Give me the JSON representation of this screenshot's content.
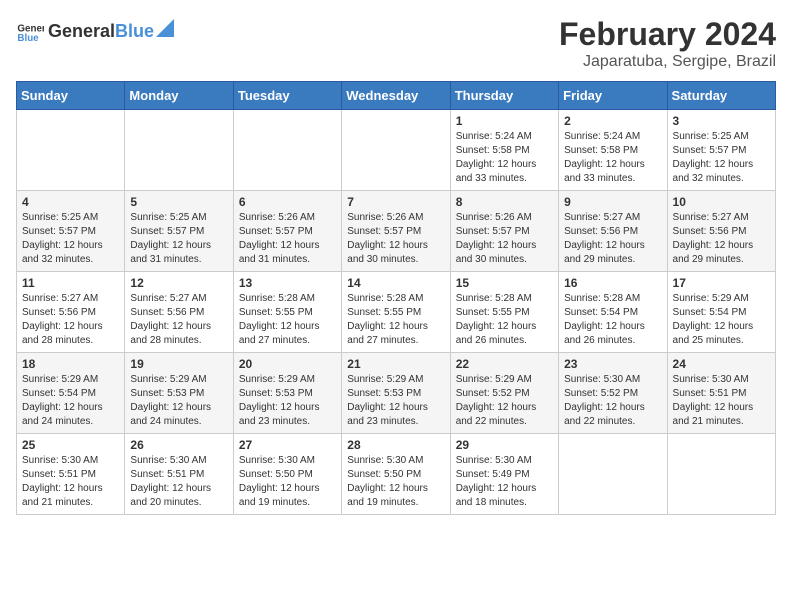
{
  "header": {
    "logo_general": "General",
    "logo_blue": "Blue",
    "month_year": "February 2024",
    "location": "Japaratuba, Sergipe, Brazil"
  },
  "days_of_week": [
    "Sunday",
    "Monday",
    "Tuesday",
    "Wednesday",
    "Thursday",
    "Friday",
    "Saturday"
  ],
  "weeks": [
    [
      {
        "day": "",
        "content": ""
      },
      {
        "day": "",
        "content": ""
      },
      {
        "day": "",
        "content": ""
      },
      {
        "day": "",
        "content": ""
      },
      {
        "day": "1",
        "content": "Sunrise: 5:24 AM\nSunset: 5:58 PM\nDaylight: 12 hours and 33 minutes."
      },
      {
        "day": "2",
        "content": "Sunrise: 5:24 AM\nSunset: 5:58 PM\nDaylight: 12 hours and 33 minutes."
      },
      {
        "day": "3",
        "content": "Sunrise: 5:25 AM\nSunset: 5:57 PM\nDaylight: 12 hours and 32 minutes."
      }
    ],
    [
      {
        "day": "4",
        "content": "Sunrise: 5:25 AM\nSunset: 5:57 PM\nDaylight: 12 hours and 32 minutes."
      },
      {
        "day": "5",
        "content": "Sunrise: 5:25 AM\nSunset: 5:57 PM\nDaylight: 12 hours and 31 minutes."
      },
      {
        "day": "6",
        "content": "Sunrise: 5:26 AM\nSunset: 5:57 PM\nDaylight: 12 hours and 31 minutes."
      },
      {
        "day": "7",
        "content": "Sunrise: 5:26 AM\nSunset: 5:57 PM\nDaylight: 12 hours and 30 minutes."
      },
      {
        "day": "8",
        "content": "Sunrise: 5:26 AM\nSunset: 5:57 PM\nDaylight: 12 hours and 30 minutes."
      },
      {
        "day": "9",
        "content": "Sunrise: 5:27 AM\nSunset: 5:56 PM\nDaylight: 12 hours and 29 minutes."
      },
      {
        "day": "10",
        "content": "Sunrise: 5:27 AM\nSunset: 5:56 PM\nDaylight: 12 hours and 29 minutes."
      }
    ],
    [
      {
        "day": "11",
        "content": "Sunrise: 5:27 AM\nSunset: 5:56 PM\nDaylight: 12 hours and 28 minutes."
      },
      {
        "day": "12",
        "content": "Sunrise: 5:27 AM\nSunset: 5:56 PM\nDaylight: 12 hours and 28 minutes."
      },
      {
        "day": "13",
        "content": "Sunrise: 5:28 AM\nSunset: 5:55 PM\nDaylight: 12 hours and 27 minutes."
      },
      {
        "day": "14",
        "content": "Sunrise: 5:28 AM\nSunset: 5:55 PM\nDaylight: 12 hours and 27 minutes."
      },
      {
        "day": "15",
        "content": "Sunrise: 5:28 AM\nSunset: 5:55 PM\nDaylight: 12 hours and 26 minutes."
      },
      {
        "day": "16",
        "content": "Sunrise: 5:28 AM\nSunset: 5:54 PM\nDaylight: 12 hours and 26 minutes."
      },
      {
        "day": "17",
        "content": "Sunrise: 5:29 AM\nSunset: 5:54 PM\nDaylight: 12 hours and 25 minutes."
      }
    ],
    [
      {
        "day": "18",
        "content": "Sunrise: 5:29 AM\nSunset: 5:54 PM\nDaylight: 12 hours and 24 minutes."
      },
      {
        "day": "19",
        "content": "Sunrise: 5:29 AM\nSunset: 5:53 PM\nDaylight: 12 hours and 24 minutes."
      },
      {
        "day": "20",
        "content": "Sunrise: 5:29 AM\nSunset: 5:53 PM\nDaylight: 12 hours and 23 minutes."
      },
      {
        "day": "21",
        "content": "Sunrise: 5:29 AM\nSunset: 5:53 PM\nDaylight: 12 hours and 23 minutes."
      },
      {
        "day": "22",
        "content": "Sunrise: 5:29 AM\nSunset: 5:52 PM\nDaylight: 12 hours and 22 minutes."
      },
      {
        "day": "23",
        "content": "Sunrise: 5:30 AM\nSunset: 5:52 PM\nDaylight: 12 hours and 22 minutes."
      },
      {
        "day": "24",
        "content": "Sunrise: 5:30 AM\nSunset: 5:51 PM\nDaylight: 12 hours and 21 minutes."
      }
    ],
    [
      {
        "day": "25",
        "content": "Sunrise: 5:30 AM\nSunset: 5:51 PM\nDaylight: 12 hours and 21 minutes."
      },
      {
        "day": "26",
        "content": "Sunrise: 5:30 AM\nSunset: 5:51 PM\nDaylight: 12 hours and 20 minutes."
      },
      {
        "day": "27",
        "content": "Sunrise: 5:30 AM\nSunset: 5:50 PM\nDaylight: 12 hours and 19 minutes."
      },
      {
        "day": "28",
        "content": "Sunrise: 5:30 AM\nSunset: 5:50 PM\nDaylight: 12 hours and 19 minutes."
      },
      {
        "day": "29",
        "content": "Sunrise: 5:30 AM\nSunset: 5:49 PM\nDaylight: 12 hours and 18 minutes."
      },
      {
        "day": "",
        "content": ""
      },
      {
        "day": "",
        "content": ""
      }
    ]
  ]
}
